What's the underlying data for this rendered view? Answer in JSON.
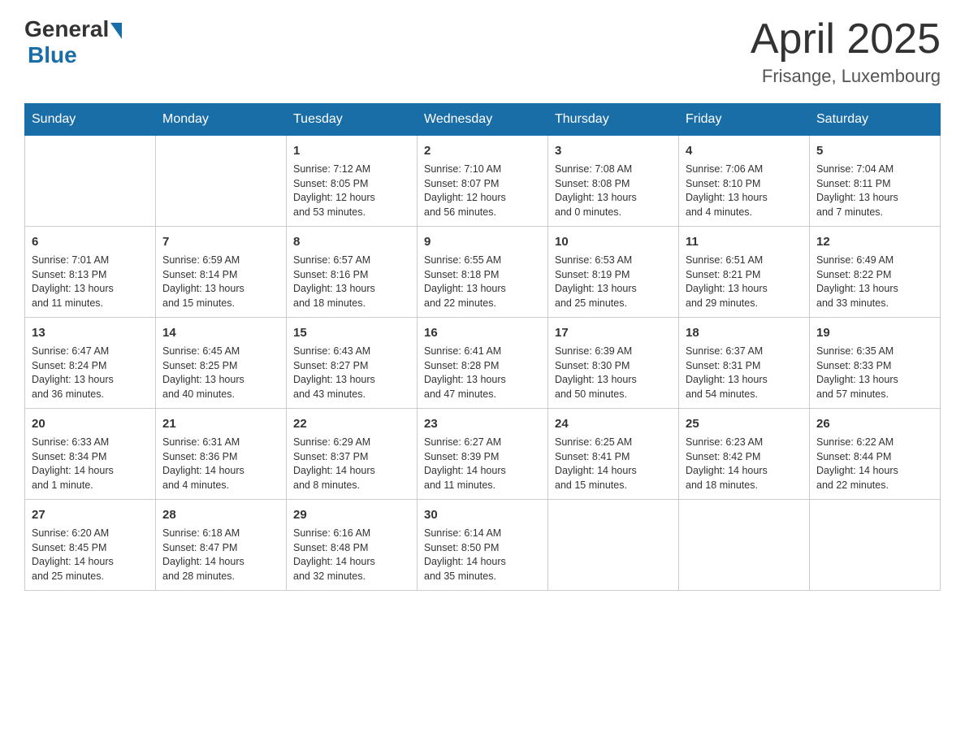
{
  "header": {
    "logo": {
      "general": "General",
      "blue": "Blue"
    },
    "title": "April 2025",
    "subtitle": "Frisange, Luxembourg"
  },
  "calendar": {
    "days_of_week": [
      "Sunday",
      "Monday",
      "Tuesday",
      "Wednesday",
      "Thursday",
      "Friday",
      "Saturday"
    ],
    "weeks": [
      [
        {
          "day": "",
          "info": ""
        },
        {
          "day": "",
          "info": ""
        },
        {
          "day": "1",
          "info": "Sunrise: 7:12 AM\nSunset: 8:05 PM\nDaylight: 12 hours\nand 53 minutes."
        },
        {
          "day": "2",
          "info": "Sunrise: 7:10 AM\nSunset: 8:07 PM\nDaylight: 12 hours\nand 56 minutes."
        },
        {
          "day": "3",
          "info": "Sunrise: 7:08 AM\nSunset: 8:08 PM\nDaylight: 13 hours\nand 0 minutes."
        },
        {
          "day": "4",
          "info": "Sunrise: 7:06 AM\nSunset: 8:10 PM\nDaylight: 13 hours\nand 4 minutes."
        },
        {
          "day": "5",
          "info": "Sunrise: 7:04 AM\nSunset: 8:11 PM\nDaylight: 13 hours\nand 7 minutes."
        }
      ],
      [
        {
          "day": "6",
          "info": "Sunrise: 7:01 AM\nSunset: 8:13 PM\nDaylight: 13 hours\nand 11 minutes."
        },
        {
          "day": "7",
          "info": "Sunrise: 6:59 AM\nSunset: 8:14 PM\nDaylight: 13 hours\nand 15 minutes."
        },
        {
          "day": "8",
          "info": "Sunrise: 6:57 AM\nSunset: 8:16 PM\nDaylight: 13 hours\nand 18 minutes."
        },
        {
          "day": "9",
          "info": "Sunrise: 6:55 AM\nSunset: 8:18 PM\nDaylight: 13 hours\nand 22 minutes."
        },
        {
          "day": "10",
          "info": "Sunrise: 6:53 AM\nSunset: 8:19 PM\nDaylight: 13 hours\nand 25 minutes."
        },
        {
          "day": "11",
          "info": "Sunrise: 6:51 AM\nSunset: 8:21 PM\nDaylight: 13 hours\nand 29 minutes."
        },
        {
          "day": "12",
          "info": "Sunrise: 6:49 AM\nSunset: 8:22 PM\nDaylight: 13 hours\nand 33 minutes."
        }
      ],
      [
        {
          "day": "13",
          "info": "Sunrise: 6:47 AM\nSunset: 8:24 PM\nDaylight: 13 hours\nand 36 minutes."
        },
        {
          "day": "14",
          "info": "Sunrise: 6:45 AM\nSunset: 8:25 PM\nDaylight: 13 hours\nand 40 minutes."
        },
        {
          "day": "15",
          "info": "Sunrise: 6:43 AM\nSunset: 8:27 PM\nDaylight: 13 hours\nand 43 minutes."
        },
        {
          "day": "16",
          "info": "Sunrise: 6:41 AM\nSunset: 8:28 PM\nDaylight: 13 hours\nand 47 minutes."
        },
        {
          "day": "17",
          "info": "Sunrise: 6:39 AM\nSunset: 8:30 PM\nDaylight: 13 hours\nand 50 minutes."
        },
        {
          "day": "18",
          "info": "Sunrise: 6:37 AM\nSunset: 8:31 PM\nDaylight: 13 hours\nand 54 minutes."
        },
        {
          "day": "19",
          "info": "Sunrise: 6:35 AM\nSunset: 8:33 PM\nDaylight: 13 hours\nand 57 minutes."
        }
      ],
      [
        {
          "day": "20",
          "info": "Sunrise: 6:33 AM\nSunset: 8:34 PM\nDaylight: 14 hours\nand 1 minute."
        },
        {
          "day": "21",
          "info": "Sunrise: 6:31 AM\nSunset: 8:36 PM\nDaylight: 14 hours\nand 4 minutes."
        },
        {
          "day": "22",
          "info": "Sunrise: 6:29 AM\nSunset: 8:37 PM\nDaylight: 14 hours\nand 8 minutes."
        },
        {
          "day": "23",
          "info": "Sunrise: 6:27 AM\nSunset: 8:39 PM\nDaylight: 14 hours\nand 11 minutes."
        },
        {
          "day": "24",
          "info": "Sunrise: 6:25 AM\nSunset: 8:41 PM\nDaylight: 14 hours\nand 15 minutes."
        },
        {
          "day": "25",
          "info": "Sunrise: 6:23 AM\nSunset: 8:42 PM\nDaylight: 14 hours\nand 18 minutes."
        },
        {
          "day": "26",
          "info": "Sunrise: 6:22 AM\nSunset: 8:44 PM\nDaylight: 14 hours\nand 22 minutes."
        }
      ],
      [
        {
          "day": "27",
          "info": "Sunrise: 6:20 AM\nSunset: 8:45 PM\nDaylight: 14 hours\nand 25 minutes."
        },
        {
          "day": "28",
          "info": "Sunrise: 6:18 AM\nSunset: 8:47 PM\nDaylight: 14 hours\nand 28 minutes."
        },
        {
          "day": "29",
          "info": "Sunrise: 6:16 AM\nSunset: 8:48 PM\nDaylight: 14 hours\nand 32 minutes."
        },
        {
          "day": "30",
          "info": "Sunrise: 6:14 AM\nSunset: 8:50 PM\nDaylight: 14 hours\nand 35 minutes."
        },
        {
          "day": "",
          "info": ""
        },
        {
          "day": "",
          "info": ""
        },
        {
          "day": "",
          "info": ""
        }
      ]
    ]
  }
}
